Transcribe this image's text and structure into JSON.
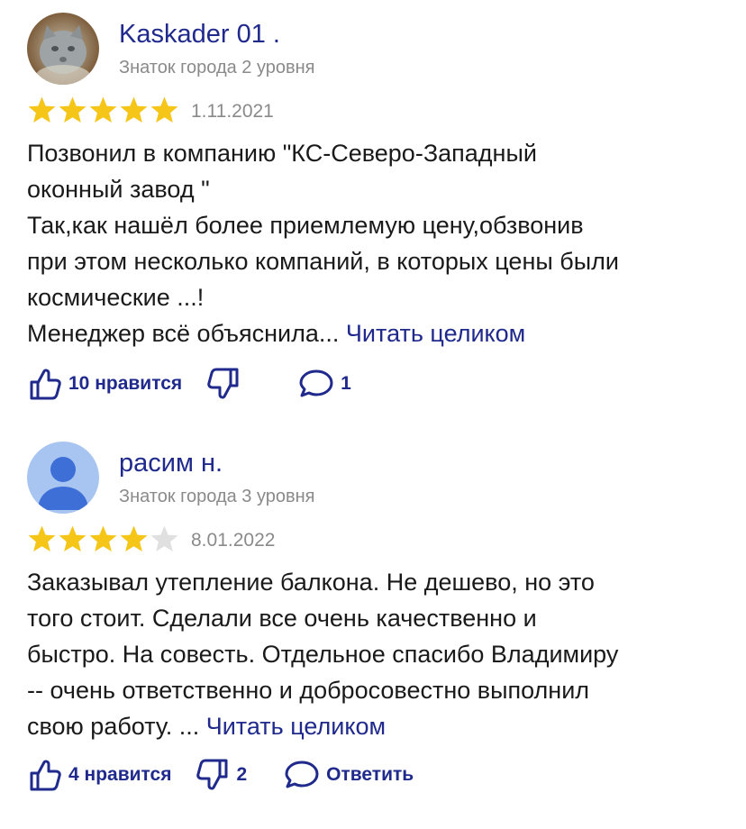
{
  "colors": {
    "link": "#1f2a8c",
    "star_on": "#f5c518",
    "star_off": "#e0e0e0",
    "muted": "#8a8a8a"
  },
  "reviews": [
    {
      "author": "Kaskader 01 .",
      "level": "Знаток города 2 уровня",
      "rating": 5,
      "date": "1.11.2021",
      "lines": [
        "Позвонил в компанию \"КС-Северо-Западный",
        "оконный завод \"",
        "Так,как нашёл более приемлемую цену,обзвонив",
        "при этом несколько компаний, в которых цены были",
        "космические ...!",
        "Менеджер всё объяснила..."
      ],
      "read_more": "Читать целиком",
      "likes_label": "10 нравится",
      "dislikes_label": "",
      "comments_label": "1",
      "avatar_icon": "cat-photo-avatar"
    },
    {
      "author": "расим н.",
      "level": "Знаток города 3 уровня",
      "rating": 4,
      "date": "8.01.2022",
      "lines": [
        "Заказывал утепление балкона. Не дешево, но это",
        "того стоит. Сделали все очень качественно и",
        "быстро. На совесть. Отдельное спасибо Владимиру",
        "-- очень ответственно и добросовестно выполнил",
        "свою работу. ..."
      ],
      "read_more": "Читать целиком",
      "likes_label": "4 нравится",
      "dislikes_label": "2",
      "comments_label": "Ответить",
      "avatar_icon": "user-silhouette-avatar"
    }
  ]
}
